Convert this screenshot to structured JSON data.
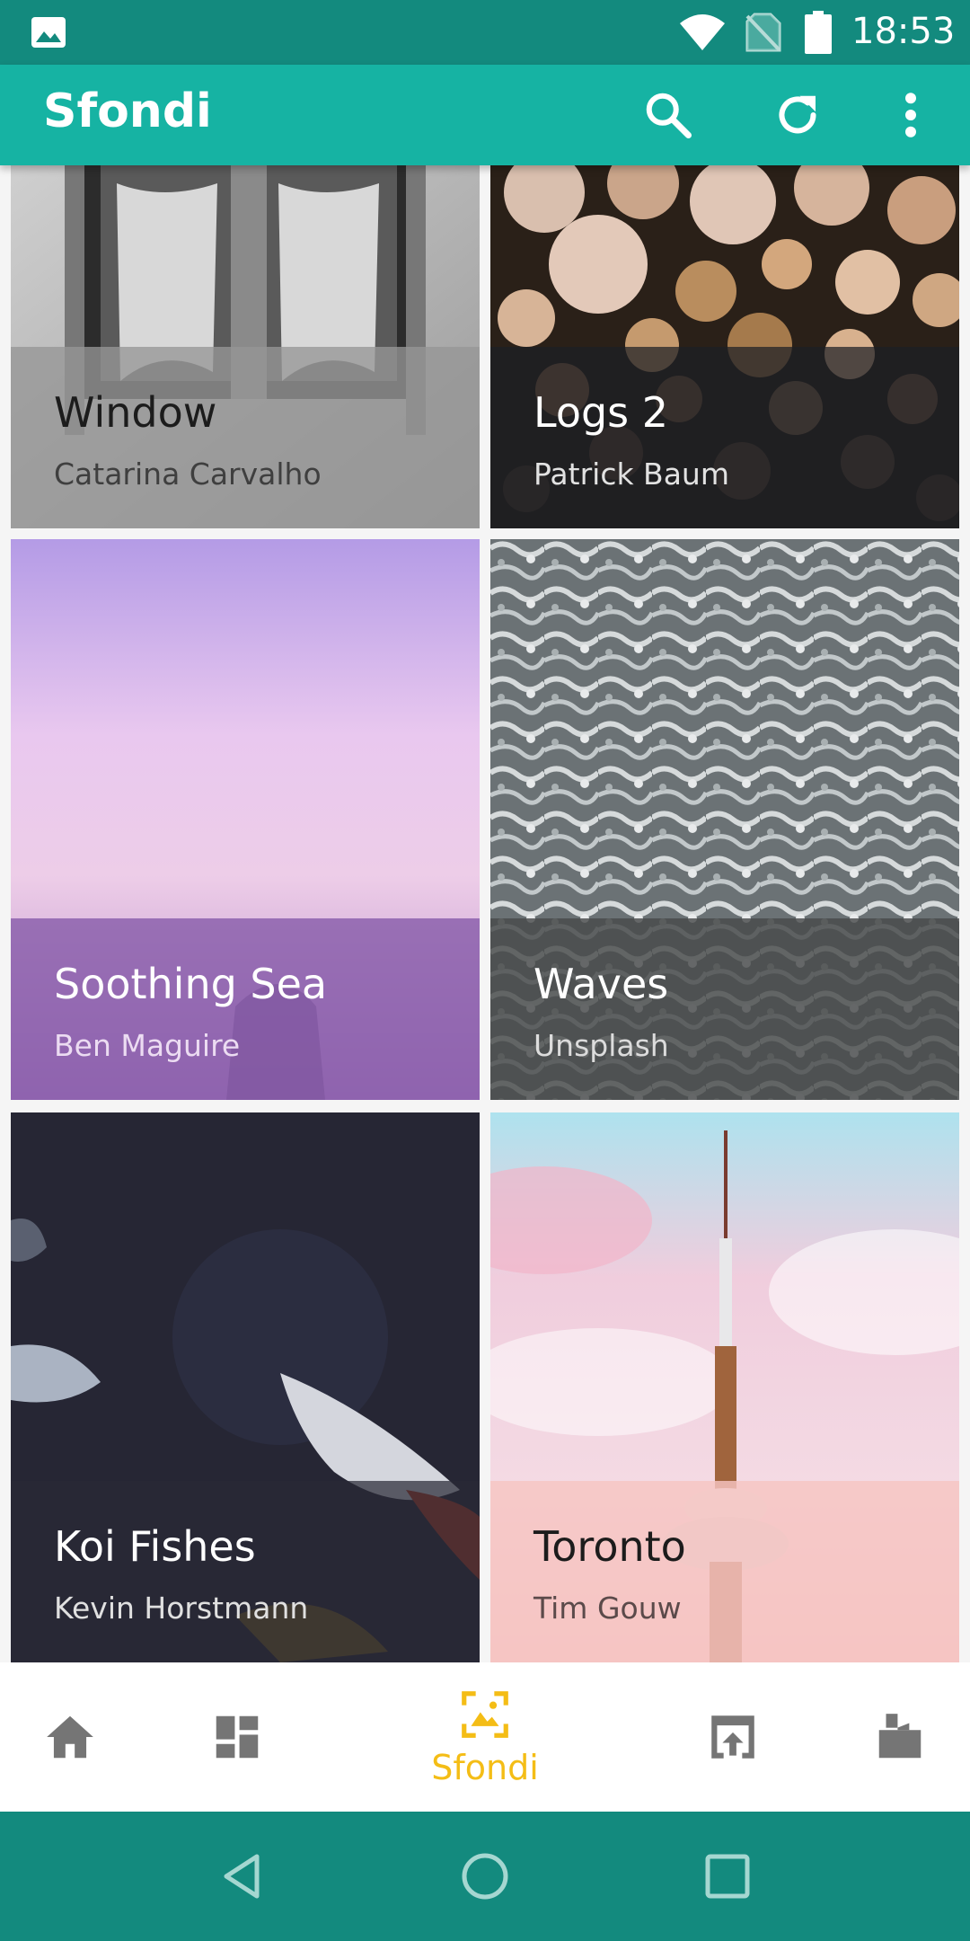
{
  "status_bar": {
    "time": "18:53",
    "icons": [
      "gallery-icon",
      "wifi-icon",
      "no-sim-icon",
      "battery-icon"
    ]
  },
  "app_bar": {
    "title": "Sfondi",
    "actions": [
      "search-icon",
      "refresh-icon",
      "more-vert-icon"
    ]
  },
  "wallpapers": [
    {
      "title": "Window",
      "author": "Catarina Carvalho",
      "text_color": "#1c1c1c"
    },
    {
      "title": "Logs 2",
      "author": "Patrick Baum",
      "text_color": "#ffffff"
    },
    {
      "title": "Soothing Sea",
      "author": "Ben Maguire",
      "text_color": "#ffffff"
    },
    {
      "title": "Waves",
      "author": "Unsplash",
      "text_color": "#ffffff"
    },
    {
      "title": "Koi Fishes",
      "author": "Kevin Horstmann",
      "text_color": "#ffffff"
    },
    {
      "title": "Toronto",
      "author": "Tim Gouw",
      "text_color": "#1c1c1c"
    }
  ],
  "bottom_nav": {
    "items": [
      {
        "icon": "home-icon",
        "label": "",
        "active": false
      },
      {
        "icon": "dashboard-icon",
        "label": "",
        "active": false
      },
      {
        "icon": "wallpaper-icon",
        "label": "Sfondi",
        "active": true
      },
      {
        "icon": "apply-icon",
        "label": "",
        "active": false
      },
      {
        "icon": "request-icon",
        "label": "",
        "active": false
      }
    ],
    "active_color": "#f4bd16",
    "inactive_color": "#757575"
  },
  "colors": {
    "primary": "#16b3a3",
    "primary_dark": "#138a7e",
    "accent": "#f4bd16"
  }
}
